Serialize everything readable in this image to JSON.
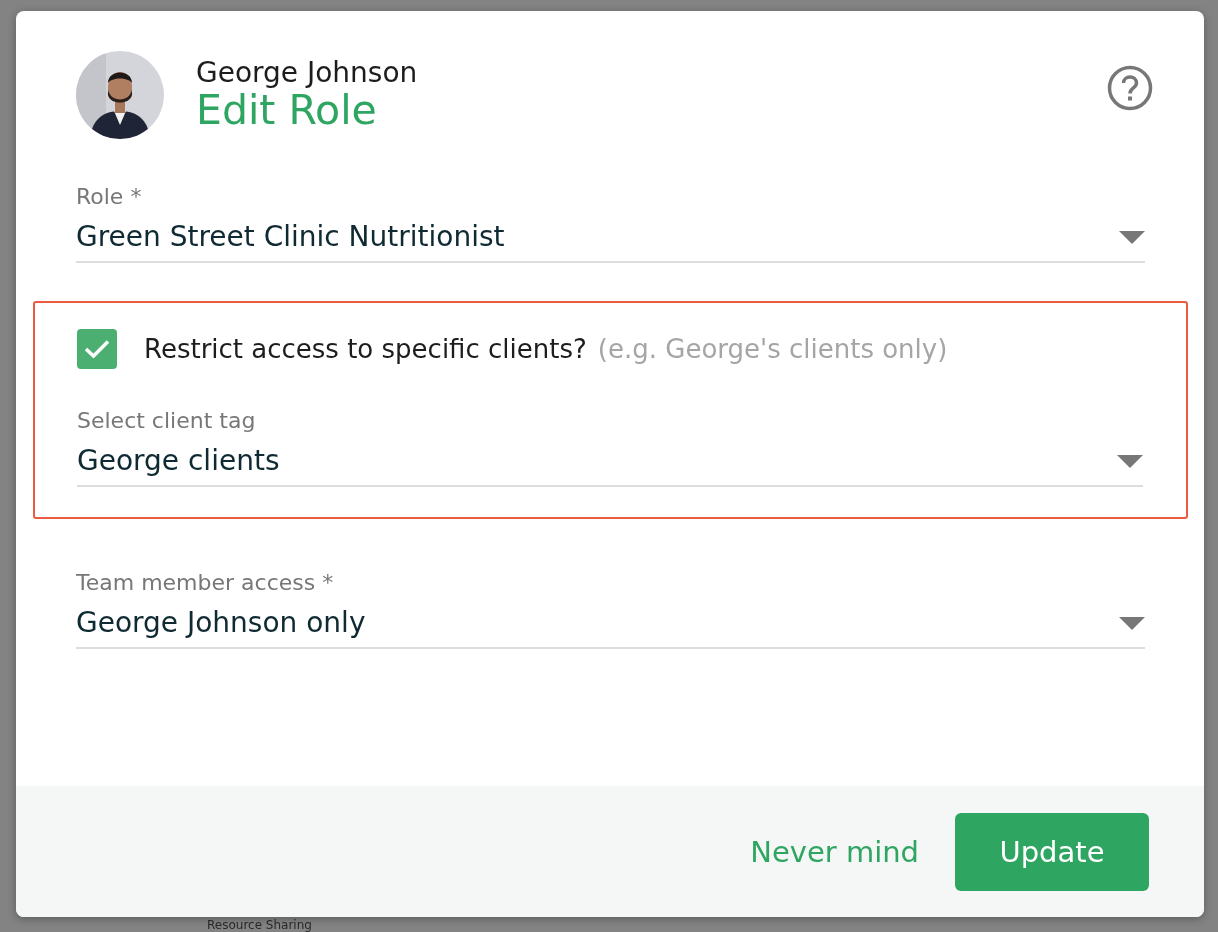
{
  "background": {
    "heading": "Resource Sharing"
  },
  "dialog": {
    "user_name": "George Johnson",
    "title": "Edit Role"
  },
  "fields": [
    {
      "label": "Role *",
      "value": "Green Street Clinic Nutritionist"
    }
  ],
  "restriction": {
    "highlighted": true,
    "checkbox": {
      "checked": true,
      "label": "Restrict access to specific clients?",
      "hint": "(e.g. George's clients only)"
    },
    "field": {
      "label": "Select client tag",
      "value": "George clients"
    }
  },
  "fields_after": [
    {
      "label": "Team member access *",
      "value": "George Johnson only"
    }
  ],
  "buttons": [
    {
      "kind": "link",
      "label": "Never mind"
    },
    {
      "kind": "primary",
      "label": "Update"
    }
  ]
}
